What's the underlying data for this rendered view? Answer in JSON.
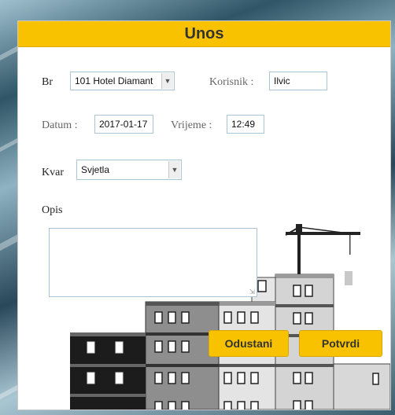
{
  "dialog": {
    "title": "Unos"
  },
  "form": {
    "br_label": "Br",
    "br_value": "101 Hotel Diamant",
    "korisnik_label": "Korisnik :",
    "korisnik_value": "Ilvic",
    "datum_label": "Datum :",
    "datum_value": "2017-01-17",
    "vrijeme_label": "Vrijeme :",
    "vrijeme_value": "12:49",
    "kvar_label": "Kvar",
    "kvar_value": "Svjetla",
    "opis_label": "Opis",
    "opis_value": ""
  },
  "buttons": {
    "cancel": "Odustani",
    "confirm": "Potvrdi"
  },
  "colors": {
    "accent": "#f9c200",
    "field_border": "#aac4d4"
  }
}
